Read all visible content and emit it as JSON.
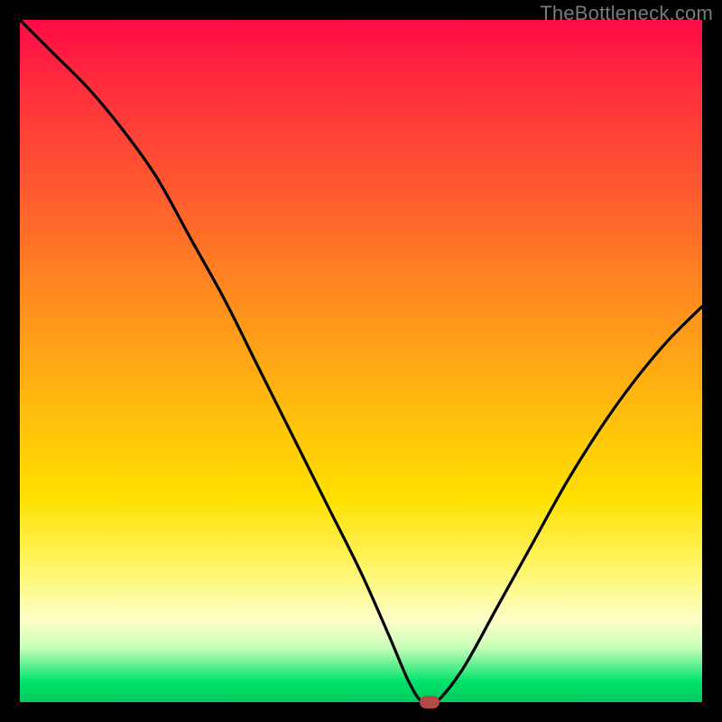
{
  "watermark": "TheBottleneck.com",
  "colors": {
    "frame": "#000000",
    "curve": "#000000",
    "marker": "#b24a46",
    "gradient_stops": [
      "#ff0b46",
      "#ff2e3c",
      "#ff5a2f",
      "#ff8a1f",
      "#ffb610",
      "#ffe000",
      "#fff566",
      "#fdffc8",
      "#c8ffb9",
      "#00e36a",
      "#00c95f"
    ]
  },
  "chart_data": {
    "type": "line",
    "title": "",
    "xlabel": "",
    "ylabel": "",
    "xlim": [
      0,
      100
    ],
    "ylim": [
      0,
      100
    ],
    "grid": false,
    "legend": false,
    "x": [
      0,
      5,
      10,
      15,
      20,
      25,
      30,
      35,
      40,
      45,
      50,
      54,
      57,
      59,
      61,
      65,
      70,
      75,
      80,
      85,
      90,
      95,
      100
    ],
    "values": [
      100,
      95,
      90,
      84,
      77,
      68,
      59,
      49,
      39,
      29,
      19,
      10,
      3,
      0,
      0,
      5,
      14,
      23,
      32,
      40,
      47,
      53,
      58
    ],
    "marker": {
      "x": 60,
      "y": 0
    },
    "notes": "V-shaped bottleneck curve; minimum at x≈59–61 touching y=0; left arm starts at y=100, right arm rises to y≈58."
  }
}
